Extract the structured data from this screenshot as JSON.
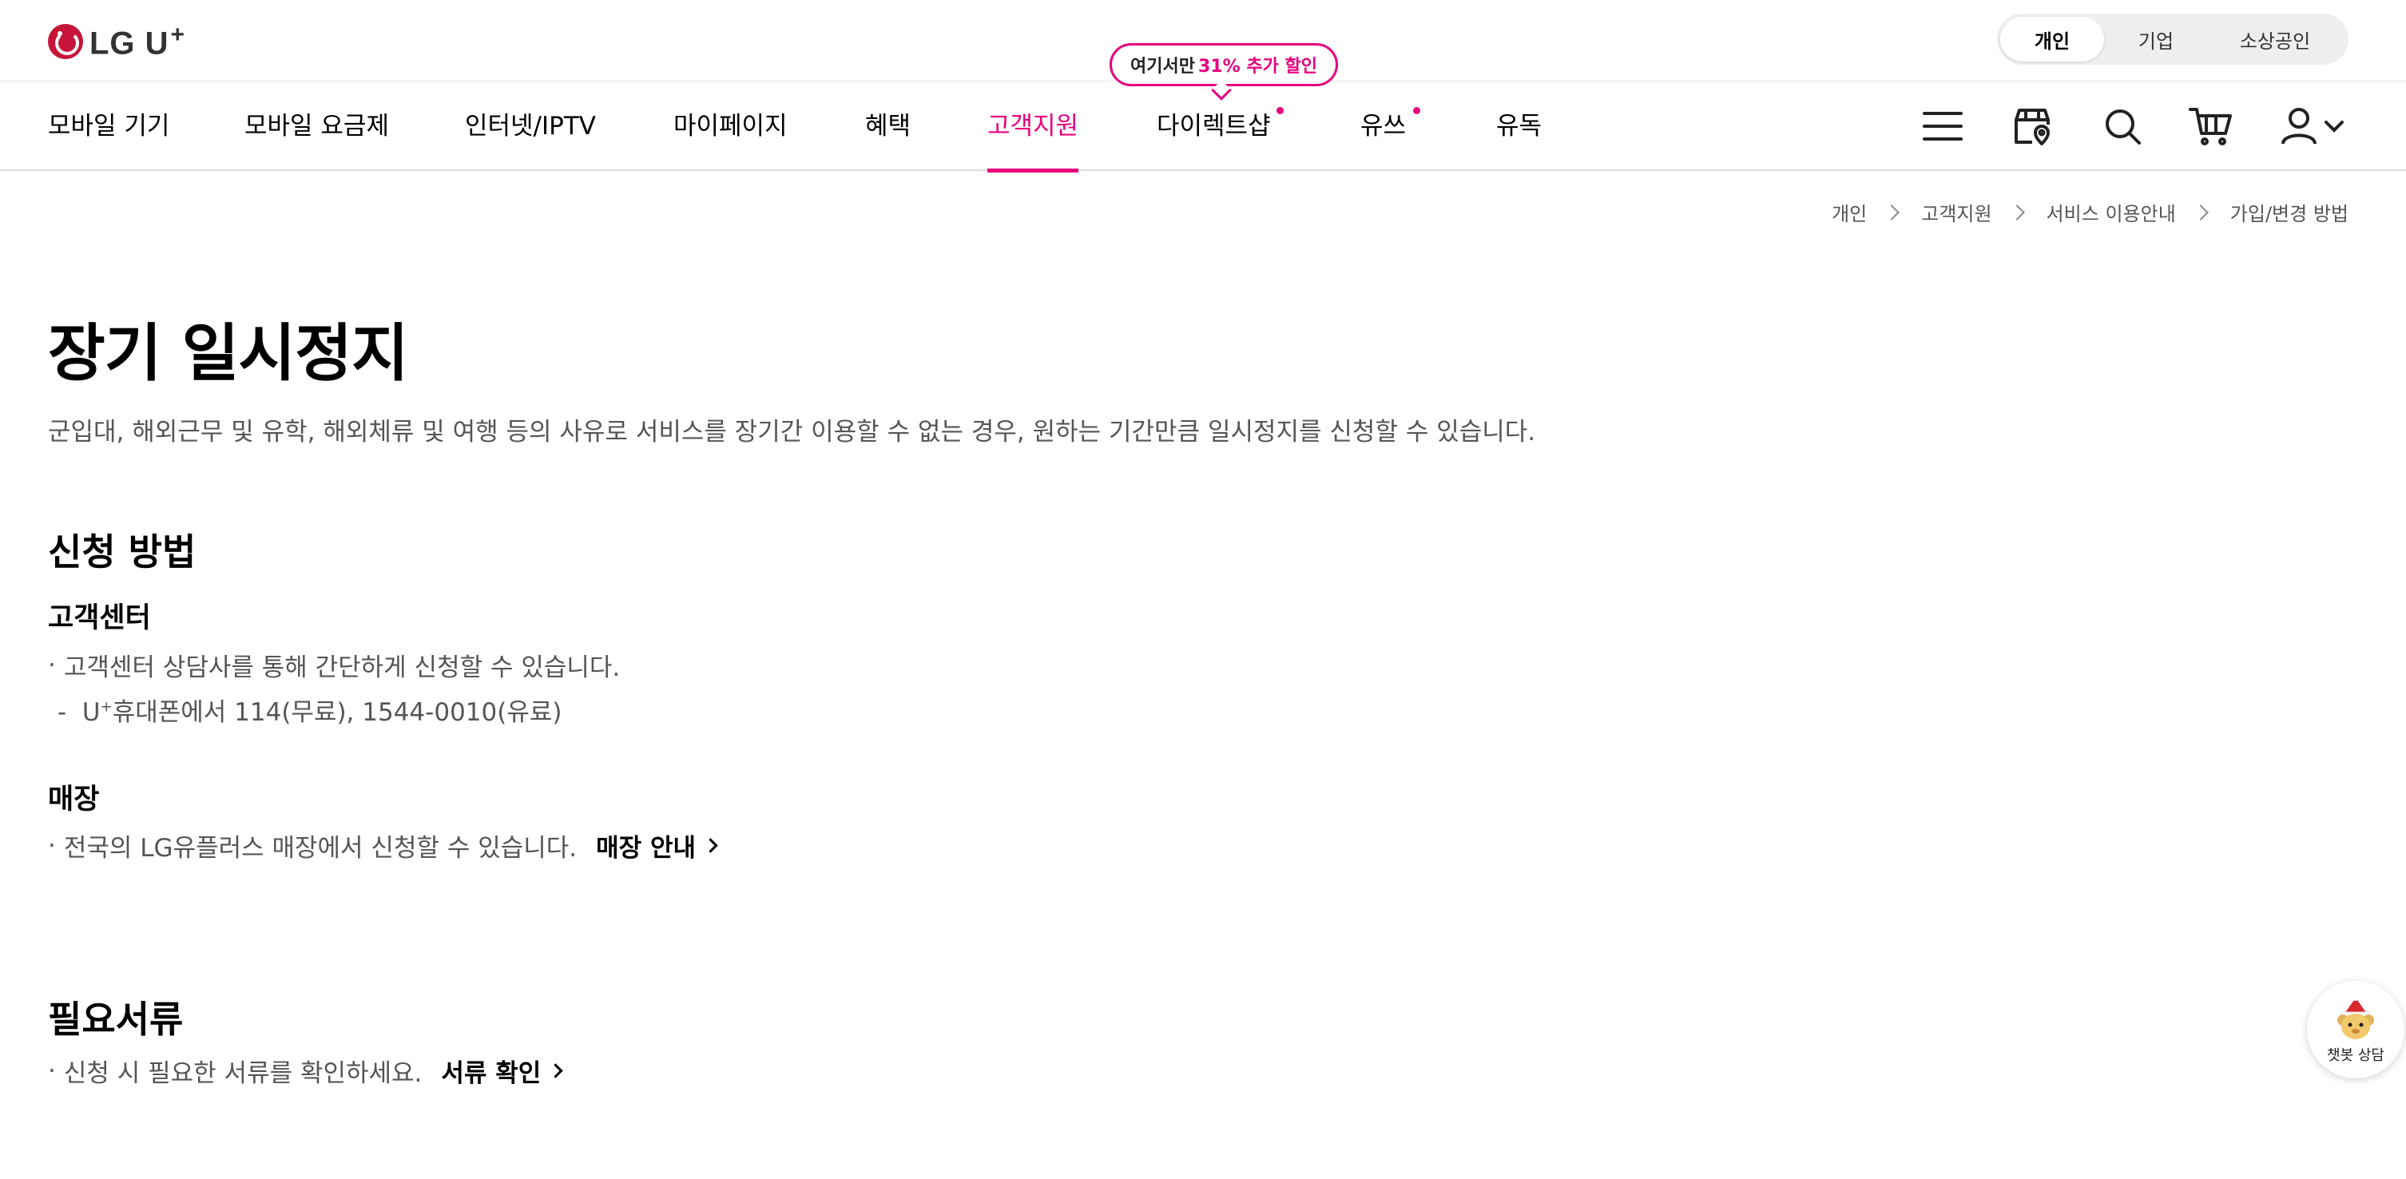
{
  "header": {
    "logo_text": "LG U",
    "logo_plus": "+",
    "segments": [
      "개인",
      "기업",
      "소상공인"
    ]
  },
  "nav": {
    "items": [
      "모바일 기기",
      "모바일 요금제",
      "인터넷/IPTV",
      "마이페이지",
      "혜택",
      "고객지원",
      "다이렉트샵",
      "유쓰",
      "유독"
    ],
    "active": "고객지원",
    "promo_prefix": "여기서만",
    "promo_highlight": "31% 추가 할인",
    "icons": [
      "menu-icon",
      "store-location-icon",
      "search-icon",
      "cart-icon",
      "user-icon"
    ]
  },
  "breadcrumb": [
    "개인",
    "고객지원",
    "서비스 이용안내",
    "가입/변경 방법"
  ],
  "page": {
    "title": "장기 일시정지",
    "description": "군입대, 해외근무 및 유학, 해외체류 및 여행 등의 사유로 서비스를 장기간 이용할 수 없는 경우, 원하는 기간만큼 일시정지를 신청할 수 있습니다."
  },
  "apply": {
    "title": "신청 방법",
    "customer_center": {
      "title": "고객센터",
      "bullet": "고객센터 상담사를 통해 간단하게 신청할 수 있습니다.",
      "detail_prefix": "U",
      "detail_sup": "+",
      "detail_rest": "휴대폰에서 114(무료), 1544-0010(유료)"
    },
    "store": {
      "title": "매장",
      "bullet": "전국의 LG유플러스 매장에서 신청할 수 있습니다.",
      "link": "매장 안내"
    }
  },
  "documents": {
    "title": "필요서류",
    "bullet": "신청 시 필요한 서류를 확인하세요.",
    "link": "서류 확인"
  },
  "chatbot": {
    "label": "챗봇 상담"
  },
  "colors": {
    "accent": "#e6007e",
    "logo": "#c5163a"
  }
}
